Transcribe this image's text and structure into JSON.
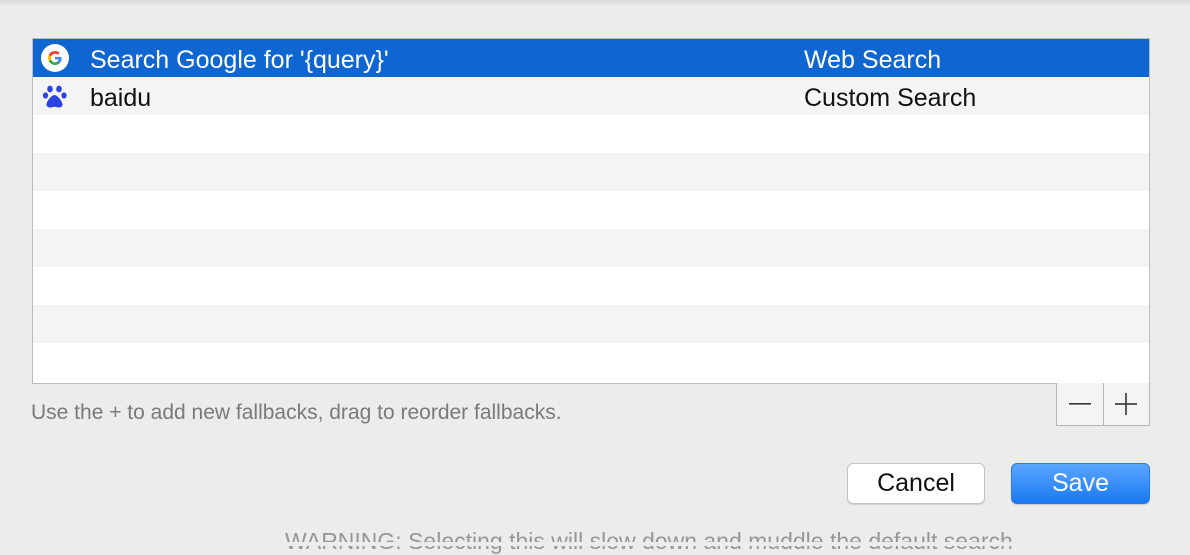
{
  "fallbacks": [
    {
      "name": "Search Google for '{query}'",
      "type": "Web Search",
      "icon": "google-icon",
      "selected": true
    },
    {
      "name": "baidu",
      "type": "Custom Search",
      "icon": "paw-icon",
      "selected": false
    }
  ],
  "hint": "Use the + to add new fallbacks, drag to reorder fallbacks.",
  "controls": {
    "minus": "—",
    "plus": "+"
  },
  "buttons": {
    "cancel": "Cancel",
    "save": "Save"
  },
  "background_text": "WARNING: Selecting this will slow down and muddle the default search",
  "colors": {
    "selection": "#0f66d0",
    "save_button": "#1a78f2",
    "baidu_icon": "#2b44e0"
  }
}
